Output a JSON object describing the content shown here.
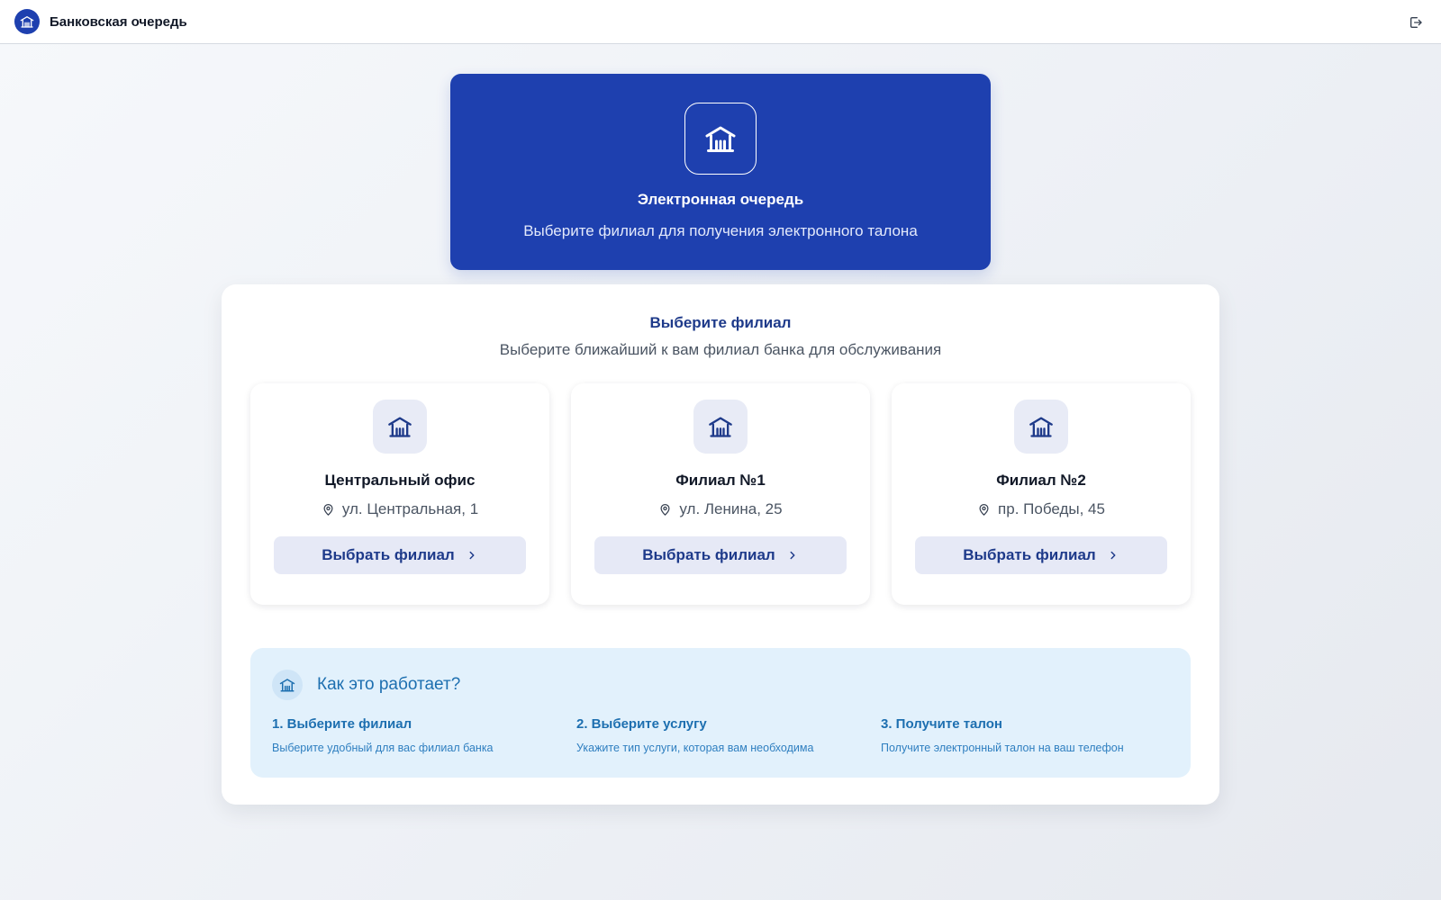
{
  "header": {
    "app_title": "Банковская очередь",
    "logo_icon": "bank-icon",
    "logout_icon": "logout-icon"
  },
  "hero": {
    "icon": "bank-icon",
    "title": "Электронная очередь",
    "subtitle": "Выберите филиал для получения электронного талона"
  },
  "branches_section": {
    "title": "Выберите филиал",
    "subtitle": "Выберите ближайший к вам филиал банка для обслуживания",
    "items": [
      {
        "name": "Центральный офис",
        "address": "ул. Центральная, 1",
        "button_label": "Выбрать филиал"
      },
      {
        "name": "Филиал №1",
        "address": "ул. Ленина, 25",
        "button_label": "Выбрать филиал"
      },
      {
        "name": "Филиал №2",
        "address": "пр. Победы, 45",
        "button_label": "Выбрать филиал"
      }
    ]
  },
  "how_it_works": {
    "title": "Как это работает?",
    "steps": [
      {
        "title": "1. Выберите филиал",
        "text": "Выберите удобный для вас филиал банка"
      },
      {
        "title": "2. Выберите услугу",
        "text": "Укажите тип услуги, которая вам необходима"
      },
      {
        "title": "3. Получите талон",
        "text": "Получите электронный талон на ваш телефон"
      }
    ]
  },
  "colors": {
    "primary": "#1e40af",
    "dark_text": "#111827",
    "info_bg": "#e2f1fc",
    "info_text": "#1d6fb0"
  }
}
